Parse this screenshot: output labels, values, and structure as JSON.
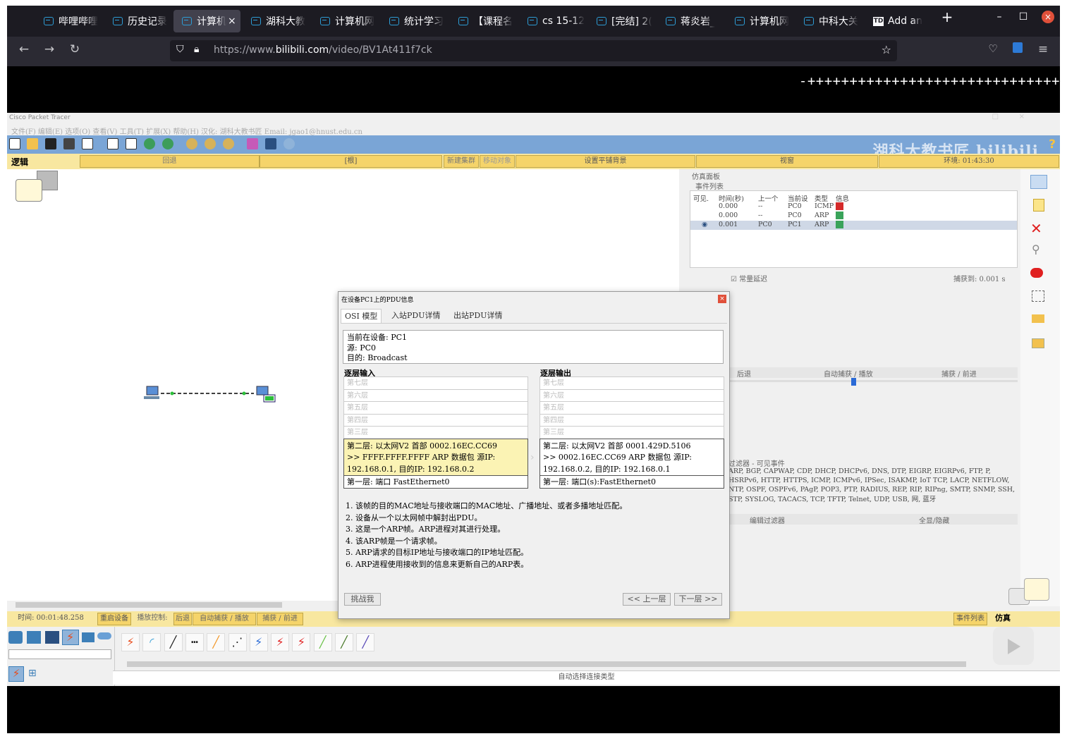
{
  "browser": {
    "tabs": [
      {
        "label": "哔哩哔哩",
        "active": false
      },
      {
        "label": "历史记录",
        "active": false
      },
      {
        "label": "计算机",
        "active": true
      },
      {
        "label": "湖科大教",
        "active": false
      },
      {
        "label": "计算机网",
        "active": false
      },
      {
        "label": "统计学习",
        "active": false
      },
      {
        "label": "【课程名",
        "active": false
      },
      {
        "label": "cs 15-12",
        "active": false
      },
      {
        "label": "[完结] 2(",
        "active": false
      },
      {
        "label": "蒋炎岩_",
        "active": false
      },
      {
        "label": "计算机网",
        "active": false
      },
      {
        "label": "中科大关",
        "active": false
      },
      {
        "label": "Add an",
        "active": false
      }
    ],
    "url_prefix": "https://www.",
    "url_domain": "bilibili.com",
    "url_path": "/video/BV1At411f7ck",
    "new_tab": "+",
    "close_tab": "×"
  },
  "video_overlay": {
    "plus_line": "-++++++++++++++++++++++++++++++",
    "watermark": "湖科大教书匠 bilibili"
  },
  "packet_tracer": {
    "app_title": "Cisco Packet Tracer",
    "menu": "文件(F)  编辑(E)  选项(O)  查看(V)  工具(T)  扩展(X)  帮助(H)  汉化: 湖科大教书匠  Email: jgao1@hnust.edu.cn",
    "logic_label": "逻辑",
    "topbar": {
      "back": "回退",
      "root": "[根]",
      "new_cluster": "新建集群",
      "move_object": "移动对象",
      "set_bg": "设置平铺背景",
      "viewport": "视窗",
      "env": "环境: 01:43:30"
    },
    "sim_panel": {
      "title": "仿真面板",
      "event_list": "事件列表",
      "headers": [
        "可见.",
        "时间(秒)",
        "上一个",
        "当前设",
        "类型",
        "信息"
      ],
      "events": [
        {
          "time": "0.000",
          "last": "--",
          "at": "PC0",
          "type": "ICMP",
          "color": "#d42a2a",
          "selected": false
        },
        {
          "time": "0.000",
          "last": "--",
          "at": "PC0",
          "type": "ARP",
          "color": "#3aa35a",
          "selected": false
        },
        {
          "time": "0.001",
          "last": "PC0",
          "at": "PC1",
          "type": "ARP",
          "color": "#3aa35a",
          "selected": true
        }
      ],
      "const_delay": "常量延迟",
      "captured": "捕获到: 0.001 s",
      "ctrl_back": "后退",
      "ctrl_auto": "自动捕获 / 播放",
      "ctrl_forward": "捕获 / 前进",
      "filter_title": "过滤器 - 可见事件",
      "filter_list": "ARP, BGP, CAPWAP, CDP, DHCP, DHCPv6, DNS, DTP, EIGRP, EIGRPv6, FTP, P, HSRPv6, HTTP, HTTPS, ICMP, ICMPv6, IPSec, ISAKMP, IoT TCP, LACP, NETFLOW, NTP, OSPF, OSPFv6, PAgP, POP3, PTP, RADIUS, REP, RIP, RIPng, SMTP, SNMP, SSH, STP, SYSLOG, TACACS, TCP, TFTP, Telnet, UDP, USB, 网, 蓝牙",
      "edit_filter": "编辑过滤器",
      "show_all": "全显/隐藏"
    },
    "status": {
      "time": "时间: 00:01:48.258",
      "restart": "重启设备",
      "playback": "播放控制:",
      "back": "后退",
      "auto": "自动捕获 / 播放",
      "forward": "捕获 / 前进",
      "event_list": "事件列表",
      "sim": "仿真"
    },
    "auto_conn": "自动选择连接类型"
  },
  "pdu_dialog": {
    "title": "在设备PC1上的PDU信息",
    "close": "×",
    "tabs": [
      "OSI 模型",
      "入站PDU详情",
      "出站PDU详情"
    ],
    "info_lines": [
      "当前在设备: PC1",
      "源: PC0",
      "目的: Broadcast"
    ],
    "in_header": "逐层输入",
    "out_header": "逐层输出",
    "in_layers": [
      "第七层",
      "第六层",
      "第五层",
      "第四层",
      "第三层"
    ],
    "in_layer2": [
      "第二层:  以太网V2 首部 0002.16EC.CC69",
      ">> FFFF.FFFF.FFFF ARP 数据包 源IP:",
      "192.168.0.1, 目的IP: 192.168.0.2"
    ],
    "in_layer1": "第一层:  端口 FastEthernet0",
    "out_layers": [
      "第七层",
      "第六层",
      "第五层",
      "第四层",
      "第三层"
    ],
    "out_layer2": [
      "第二层:  以太网V2 首部 0001.429D.5106",
      ">> 0002.16EC.CC69 ARP 数据包 源IP:",
      "192.168.0.2, 目的IP: 192.168.0.1"
    ],
    "out_layer1": "第一层:  端口(s):FastEthernet0",
    "steps": [
      "1. 该帧的目的MAC地址与接收端口的MAC地址、广播地址、或者多播地址匹配。",
      "2. 设备从一个以太网帧中解封出PDU。",
      "3. 这是一个ARP帧。ARP进程对其进行处理。",
      "4. 该ARP帧是一个请求帧。",
      "5. ARP请求的目标IP地址与接收端口的IP地址匹配。",
      "6. ARP进程使用接收到的信息来更新自己的ARP表。"
    ],
    "challenge": "挑战我",
    "prev": "<< 上一层",
    "next": "下一层 >>"
  }
}
